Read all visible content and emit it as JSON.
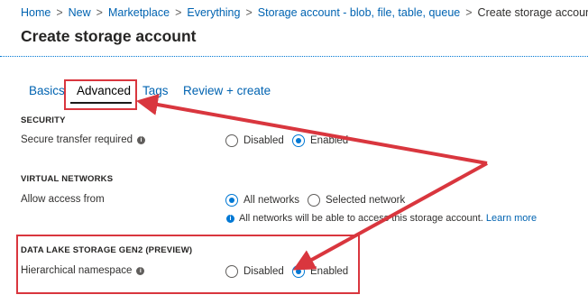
{
  "breadcrumb": {
    "items": [
      "Home",
      "New",
      "Marketplace",
      "Everything",
      "Storage account - blob, file, table, queue"
    ],
    "current": "Create storage account",
    "separator": ">"
  },
  "page_title": "Create storage account",
  "tabs": [
    {
      "label": "Basics",
      "active": false
    },
    {
      "label": "Advanced",
      "active": true
    },
    {
      "label": "Tags",
      "active": false
    },
    {
      "label": "Review + create",
      "active": false
    }
  ],
  "security": {
    "heading": "SECURITY",
    "field_label": "Secure transfer required",
    "info_icon": "info-icon",
    "options": [
      {
        "label": "Disabled",
        "checked": false
      },
      {
        "label": "Enabled",
        "checked": true
      }
    ]
  },
  "virtual_networks": {
    "heading": "VIRTUAL NETWORKS",
    "field_label": "Allow access from",
    "options": [
      {
        "label": "All networks",
        "checked": true
      },
      {
        "label": "Selected network",
        "checked": false
      }
    ],
    "note": "All networks will be able to access this storage account.",
    "note_link": "Learn more",
    "note_icon": "info-icon"
  },
  "data_lake": {
    "heading": "DATA LAKE STORAGE GEN2 (PREVIEW)",
    "field_label": "Hierarchical namespace",
    "info_icon": "info-icon",
    "options": [
      {
        "label": "Disabled",
        "checked": false
      },
      {
        "label": "Enabled",
        "checked": true
      }
    ]
  },
  "colors": {
    "accent": "#0078d4",
    "link": "#0063b1",
    "annotation": "#d9363e"
  }
}
